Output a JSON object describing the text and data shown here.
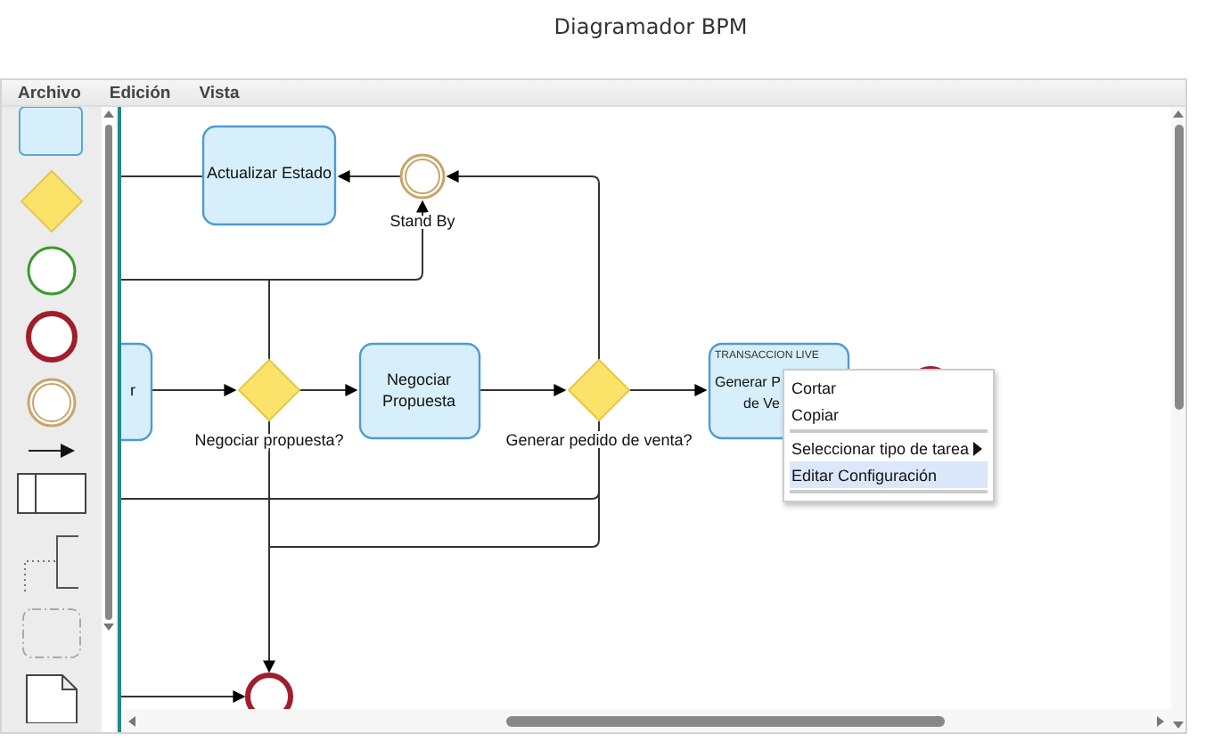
{
  "window": {
    "title": "Diagramador BPM"
  },
  "menu": [
    "Archivo",
    "Edición",
    "Vista"
  ],
  "diagram": {
    "tasks": [
      {
        "lines": [
          "r"
        ]
      },
      {
        "lines": [
          "Actualizar Estado"
        ]
      },
      {
        "lines": [
          "Negociar",
          "Propuesta"
        ]
      },
      {
        "header": "TRANSACCION LIVE",
        "lines": [
          "Generar P",
          "de Ve"
        ]
      }
    ],
    "gateways": [
      {
        "label": "Negociar propuesta?"
      },
      {
        "label": "Generar pedido de venta?"
      }
    ],
    "events": [
      {
        "kind": "intermediate",
        "label": "Stand By"
      },
      {
        "kind": "end"
      },
      {
        "kind": "end"
      }
    ]
  },
  "context_menu": [
    {
      "label": "Cortar",
      "selected": false
    },
    {
      "label": "Copiar",
      "selected": false,
      "separator_after": true
    },
    {
      "label": "Seleccionar tipo de tarea",
      "selected": false,
      "submenu": true
    },
    {
      "label": "Editar Configuración",
      "selected": true,
      "separator_after": true
    }
  ]
}
